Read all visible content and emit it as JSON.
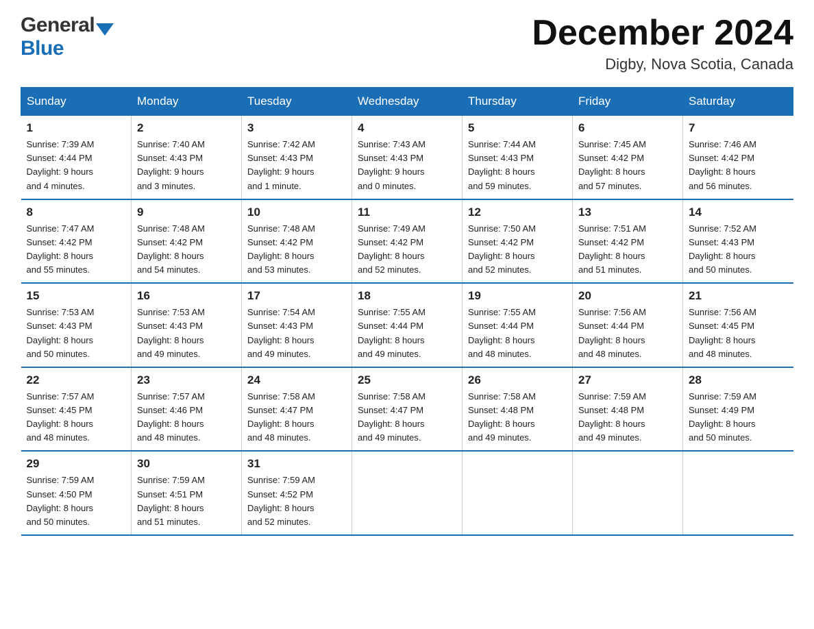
{
  "logo": {
    "general": "General",
    "blue": "Blue"
  },
  "title": {
    "month": "December 2024",
    "location": "Digby, Nova Scotia, Canada"
  },
  "header_days": [
    "Sunday",
    "Monday",
    "Tuesday",
    "Wednesday",
    "Thursday",
    "Friday",
    "Saturday"
  ],
  "weeks": [
    [
      {
        "num": "1",
        "info": "Sunrise: 7:39 AM\nSunset: 4:44 PM\nDaylight: 9 hours\nand 4 minutes."
      },
      {
        "num": "2",
        "info": "Sunrise: 7:40 AM\nSunset: 4:43 PM\nDaylight: 9 hours\nand 3 minutes."
      },
      {
        "num": "3",
        "info": "Sunrise: 7:42 AM\nSunset: 4:43 PM\nDaylight: 9 hours\nand 1 minute."
      },
      {
        "num": "4",
        "info": "Sunrise: 7:43 AM\nSunset: 4:43 PM\nDaylight: 9 hours\nand 0 minutes."
      },
      {
        "num": "5",
        "info": "Sunrise: 7:44 AM\nSunset: 4:43 PM\nDaylight: 8 hours\nand 59 minutes."
      },
      {
        "num": "6",
        "info": "Sunrise: 7:45 AM\nSunset: 4:42 PM\nDaylight: 8 hours\nand 57 minutes."
      },
      {
        "num": "7",
        "info": "Sunrise: 7:46 AM\nSunset: 4:42 PM\nDaylight: 8 hours\nand 56 minutes."
      }
    ],
    [
      {
        "num": "8",
        "info": "Sunrise: 7:47 AM\nSunset: 4:42 PM\nDaylight: 8 hours\nand 55 minutes."
      },
      {
        "num": "9",
        "info": "Sunrise: 7:48 AM\nSunset: 4:42 PM\nDaylight: 8 hours\nand 54 minutes."
      },
      {
        "num": "10",
        "info": "Sunrise: 7:48 AM\nSunset: 4:42 PM\nDaylight: 8 hours\nand 53 minutes."
      },
      {
        "num": "11",
        "info": "Sunrise: 7:49 AM\nSunset: 4:42 PM\nDaylight: 8 hours\nand 52 minutes."
      },
      {
        "num": "12",
        "info": "Sunrise: 7:50 AM\nSunset: 4:42 PM\nDaylight: 8 hours\nand 52 minutes."
      },
      {
        "num": "13",
        "info": "Sunrise: 7:51 AM\nSunset: 4:42 PM\nDaylight: 8 hours\nand 51 minutes."
      },
      {
        "num": "14",
        "info": "Sunrise: 7:52 AM\nSunset: 4:43 PM\nDaylight: 8 hours\nand 50 minutes."
      }
    ],
    [
      {
        "num": "15",
        "info": "Sunrise: 7:53 AM\nSunset: 4:43 PM\nDaylight: 8 hours\nand 50 minutes."
      },
      {
        "num": "16",
        "info": "Sunrise: 7:53 AM\nSunset: 4:43 PM\nDaylight: 8 hours\nand 49 minutes."
      },
      {
        "num": "17",
        "info": "Sunrise: 7:54 AM\nSunset: 4:43 PM\nDaylight: 8 hours\nand 49 minutes."
      },
      {
        "num": "18",
        "info": "Sunrise: 7:55 AM\nSunset: 4:44 PM\nDaylight: 8 hours\nand 49 minutes."
      },
      {
        "num": "19",
        "info": "Sunrise: 7:55 AM\nSunset: 4:44 PM\nDaylight: 8 hours\nand 48 minutes."
      },
      {
        "num": "20",
        "info": "Sunrise: 7:56 AM\nSunset: 4:44 PM\nDaylight: 8 hours\nand 48 minutes."
      },
      {
        "num": "21",
        "info": "Sunrise: 7:56 AM\nSunset: 4:45 PM\nDaylight: 8 hours\nand 48 minutes."
      }
    ],
    [
      {
        "num": "22",
        "info": "Sunrise: 7:57 AM\nSunset: 4:45 PM\nDaylight: 8 hours\nand 48 minutes."
      },
      {
        "num": "23",
        "info": "Sunrise: 7:57 AM\nSunset: 4:46 PM\nDaylight: 8 hours\nand 48 minutes."
      },
      {
        "num": "24",
        "info": "Sunrise: 7:58 AM\nSunset: 4:47 PM\nDaylight: 8 hours\nand 48 minutes."
      },
      {
        "num": "25",
        "info": "Sunrise: 7:58 AM\nSunset: 4:47 PM\nDaylight: 8 hours\nand 49 minutes."
      },
      {
        "num": "26",
        "info": "Sunrise: 7:58 AM\nSunset: 4:48 PM\nDaylight: 8 hours\nand 49 minutes."
      },
      {
        "num": "27",
        "info": "Sunrise: 7:59 AM\nSunset: 4:48 PM\nDaylight: 8 hours\nand 49 minutes."
      },
      {
        "num": "28",
        "info": "Sunrise: 7:59 AM\nSunset: 4:49 PM\nDaylight: 8 hours\nand 50 minutes."
      }
    ],
    [
      {
        "num": "29",
        "info": "Sunrise: 7:59 AM\nSunset: 4:50 PM\nDaylight: 8 hours\nand 50 minutes."
      },
      {
        "num": "30",
        "info": "Sunrise: 7:59 AM\nSunset: 4:51 PM\nDaylight: 8 hours\nand 51 minutes."
      },
      {
        "num": "31",
        "info": "Sunrise: 7:59 AM\nSunset: 4:52 PM\nDaylight: 8 hours\nand 52 minutes."
      },
      null,
      null,
      null,
      null
    ]
  ]
}
